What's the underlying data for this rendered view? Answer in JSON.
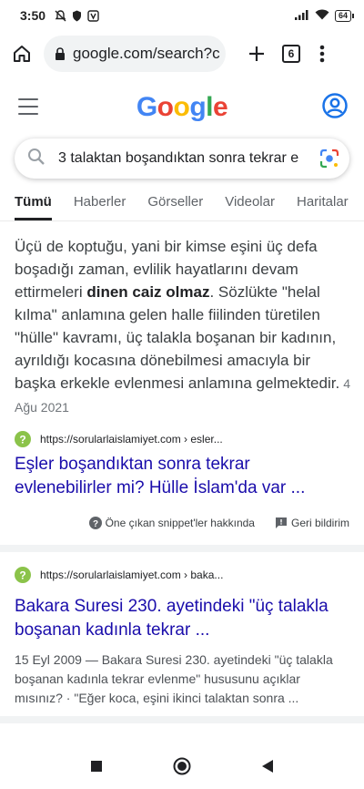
{
  "status": {
    "time": "3:50",
    "battery": "64"
  },
  "browser": {
    "url": "google.com/search?c",
    "tab_count": "6"
  },
  "google": {
    "logo_letters": [
      {
        "char": "G",
        "color": "#4285F4"
      },
      {
        "char": "o",
        "color": "#EA4335"
      },
      {
        "char": "o",
        "color": "#FBBC05"
      },
      {
        "char": "g",
        "color": "#4285F4"
      },
      {
        "char": "l",
        "color": "#34A853"
      },
      {
        "char": "e",
        "color": "#EA4335"
      }
    ],
    "query": "3 talaktan boşandıktan sonra tekrar e"
  },
  "tabs": [
    "Tümü",
    "Haberler",
    "Görseller",
    "Videolar",
    "Haritalar"
  ],
  "featured": {
    "text_before": "Üçü de koptuğu, yani bir kimse eşini üç defa boşadığı zaman, evlilik hayatlarını devam ettirmeleri ",
    "text_bold": "dinen caiz olmaz",
    "text_after": ". Sözlükte \"helal kılma\" anlamına gelen halle fiilinden türetilen \"hülle\" kavramı, üç talakla boşanan bir kadının, ayrıldığı kocasına dönebilmesi amacıyla bir başka erkekle evlenmesi anlamına gelmektedir.",
    "date": "4 Ağu 2021",
    "source": "https://sorularlaislamiyet.com › esler...",
    "title": "Eşler boşandıktan sonra tekrar evlenebilirler mi? Hülle İslam'da var ...",
    "about": "Öne çıkan snippet'ler hakkında",
    "feedback": "Geri bildirim"
  },
  "result2": {
    "source": "https://sorularlaislamiyet.com › baka...",
    "title": "Bakara Suresi 230. ayetindeki \"üç talakla boşanan kadınla tekrar ...",
    "desc": "15 Eyl 2009 — Bakara Suresi 230. ayetindeki \"üç talakla boşanan kadınla tekrar evlenme\" hususunu açıklar mısınız? · \"Eğer koca, eşini ikinci talaktan sonra ..."
  },
  "colors": {
    "link": "#1a0dab",
    "favicon": "#8bc34a"
  }
}
